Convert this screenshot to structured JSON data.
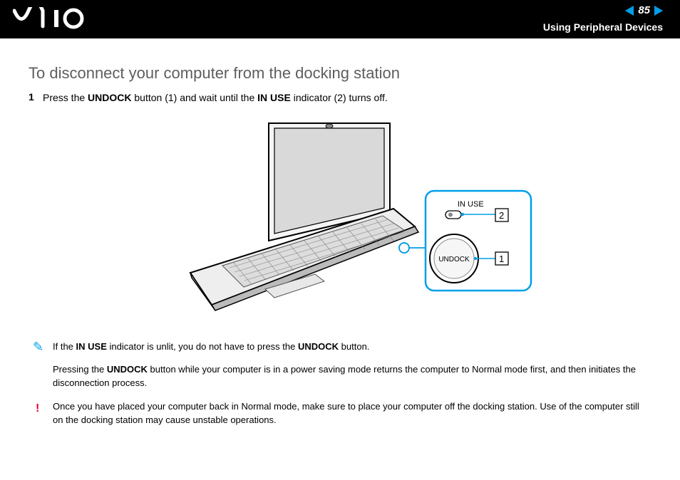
{
  "header": {
    "page_number": "85",
    "section": "Using Peripheral Devices"
  },
  "title": "To disconnect your computer from the docking station",
  "step1_num": "1",
  "step1_pre": "Press the ",
  "step1_b1": "UNDOCK",
  "step1_mid": " button (1) and wait until the ",
  "step1_b2": "IN USE",
  "step1_end": " indicator (2) turns off.",
  "diagram": {
    "in_use_label": "IN USE",
    "undock_label": "UNDOCK",
    "callout_1": "1",
    "callout_2": "2"
  },
  "note1_pre": "If the ",
  "note1_b1": "IN USE",
  "note1_mid": " indicator is unlit, you do not have to press the ",
  "note1_b2": "UNDOCK",
  "note1_end": " button.",
  "note2_pre": "Pressing the ",
  "note2_b1": "UNDOCK",
  "note2_end": " button while your computer is in a power saving mode returns the computer to Normal mode first, and then initiates the disconnection process.",
  "warn_icon": "!",
  "warn_text": "Once you have placed your computer back in Normal mode, make sure to place your computer off the docking station. Use of the computer still on the docking station may cause unstable operations."
}
